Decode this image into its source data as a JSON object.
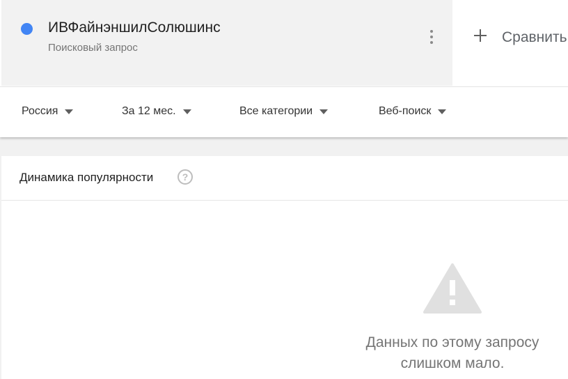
{
  "colors": {
    "term_dot": "#4285f4",
    "warning_icon": "#e0e0e0"
  },
  "term": {
    "name": "ИВФайнэншилСолюшинс",
    "subtitle": "Поисковый запрос",
    "menu_icon": "more-vert-icon"
  },
  "compare": {
    "label": "Сравнить",
    "icon": "plus-icon"
  },
  "filters": {
    "region": "Россия",
    "period": "За 12 мес.",
    "category": "Все категории",
    "search_type": "Веб-поиск"
  },
  "interest_card": {
    "title": "Динамика популярности",
    "help_icon": "?",
    "empty_line1": "Данных по этому запросу",
    "empty_line2": "слишком мало."
  }
}
